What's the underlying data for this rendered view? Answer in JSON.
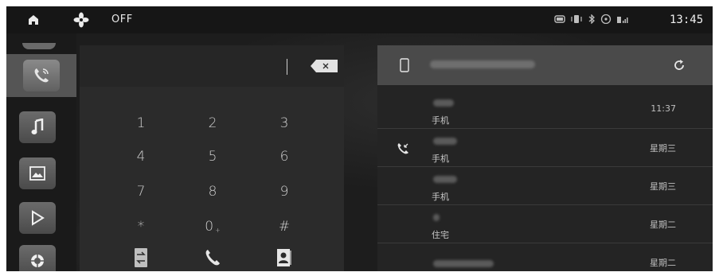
{
  "status_bar": {
    "fan_state": "OFF",
    "clock": "13:45",
    "icons": [
      "home-icon",
      "fan-icon",
      "media-icon",
      "vibrate-icon",
      "bluetooth-icon",
      "wifi-icon",
      "signal-icon"
    ]
  },
  "sidebar": {
    "items": [
      {
        "name": "phone",
        "icon": "phone-icon",
        "active": true
      },
      {
        "name": "music",
        "icon": "music-note-icon",
        "active": false
      },
      {
        "name": "gallery",
        "icon": "image-icon",
        "active": false
      },
      {
        "name": "video",
        "icon": "play-icon",
        "active": false
      },
      {
        "name": "settings",
        "icon": "settings-icon",
        "active": false
      }
    ]
  },
  "dialer": {
    "number_value": "",
    "keys": [
      {
        "label": "1",
        "sub": ""
      },
      {
        "label": "2",
        "sub": ""
      },
      {
        "label": "3",
        "sub": ""
      },
      {
        "label": "4",
        "sub": ""
      },
      {
        "label": "5",
        "sub": ""
      },
      {
        "label": "6",
        "sub": ""
      },
      {
        "label": "7",
        "sub": ""
      },
      {
        "label": "8",
        "sub": ""
      },
      {
        "label": "9",
        "sub": ""
      },
      {
        "label": "*",
        "sub": ""
      },
      {
        "label": "0",
        "sub": "+"
      },
      {
        "label": "#",
        "sub": ""
      }
    ],
    "actions": [
      "switch-audio-icon",
      "call-icon",
      "contacts-icon"
    ]
  },
  "calls": {
    "items": [
      {
        "type": "手机",
        "time": "11:37",
        "icon": ""
      },
      {
        "type": "手机",
        "time": "星期三",
        "icon": "incoming-call-icon"
      },
      {
        "type": "手机",
        "time": "星期三",
        "icon": ""
      },
      {
        "type": "住宅",
        "time": "星期二",
        "icon": ""
      },
      {
        "type": "",
        "time": "星期二",
        "icon": ""
      }
    ]
  },
  "colors": {
    "background": "#1d1d1d",
    "panel": "#2b2b2b",
    "header": "#4a4a4a",
    "text": "#cfcfcf"
  }
}
